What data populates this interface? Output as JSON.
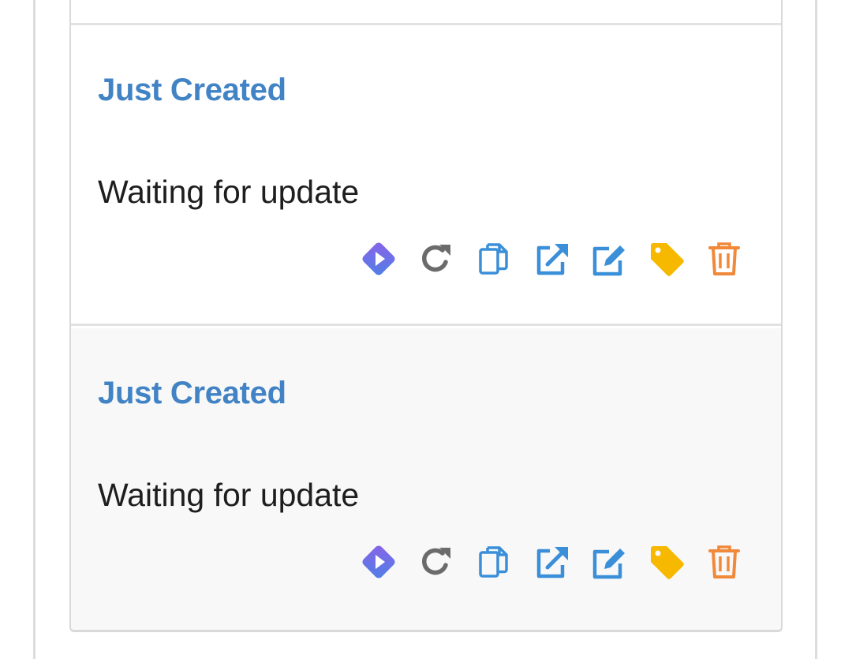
{
  "items": [
    {
      "title": "Just Created",
      "status": "Waiting for update",
      "actions": [
        {
          "icon": "play-diamond-icon",
          "color": "#6a6cf0"
        },
        {
          "icon": "redo-icon",
          "color": "#6b6b6b"
        },
        {
          "icon": "copy-icon",
          "color": "#3b8fd9"
        },
        {
          "icon": "external-link-icon",
          "color": "#3b8fd9"
        },
        {
          "icon": "edit-icon",
          "color": "#3b8fd9"
        },
        {
          "icon": "tag-icon",
          "color": "#f7b900"
        },
        {
          "icon": "trash-icon",
          "color": "#f0893a"
        }
      ]
    },
    {
      "title": "Just Created",
      "status": "Waiting for update",
      "actions": [
        {
          "icon": "play-diamond-icon",
          "color": "#6a6cf0"
        },
        {
          "icon": "redo-icon",
          "color": "#6b6b6b"
        },
        {
          "icon": "copy-icon",
          "color": "#3b8fd9"
        },
        {
          "icon": "external-link-icon",
          "color": "#3b8fd9"
        },
        {
          "icon": "edit-icon",
          "color": "#3b8fd9"
        },
        {
          "icon": "tag-icon",
          "color": "#f7b900"
        },
        {
          "icon": "trash-icon",
          "color": "#f0893a"
        }
      ]
    }
  ],
  "colors": {
    "title": "#4183c4",
    "status_text": "#1e1e1e",
    "alt_row_background": "#f8f8f8",
    "border": "#e2e2e2"
  }
}
